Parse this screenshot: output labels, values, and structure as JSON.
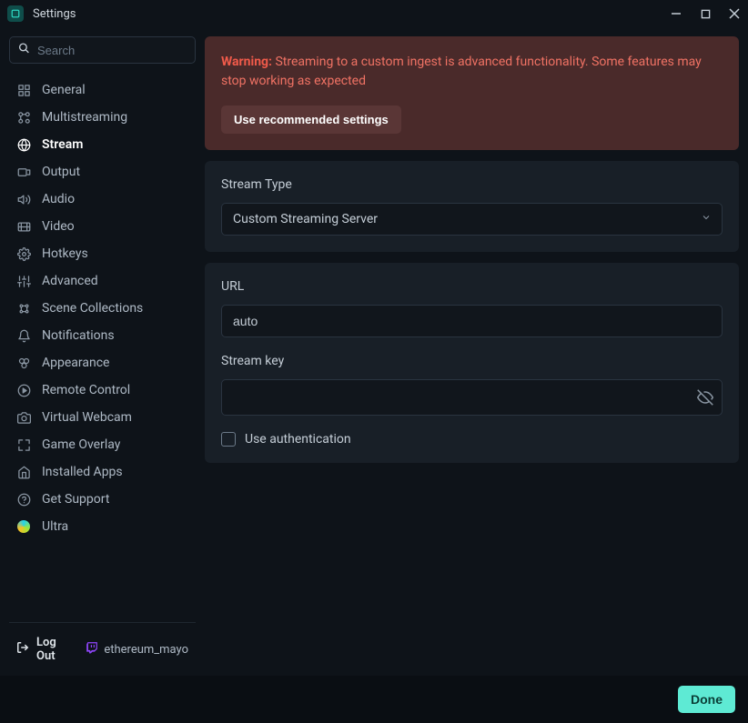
{
  "window": {
    "title": "Settings"
  },
  "search": {
    "placeholder": "Search"
  },
  "sidebar": {
    "items": [
      {
        "icon": "grid",
        "label": "General"
      },
      {
        "icon": "multistream",
        "label": "Multistreaming"
      },
      {
        "icon": "globe",
        "label": "Stream",
        "active": true
      },
      {
        "icon": "output",
        "label": "Output"
      },
      {
        "icon": "audio",
        "label": "Audio"
      },
      {
        "icon": "video",
        "label": "Video"
      },
      {
        "icon": "gear",
        "label": "Hotkeys"
      },
      {
        "icon": "sliders",
        "label": "Advanced"
      },
      {
        "icon": "collections",
        "label": "Scene Collections"
      },
      {
        "icon": "bell",
        "label": "Notifications"
      },
      {
        "icon": "appearance",
        "label": "Appearance"
      },
      {
        "icon": "remote",
        "label": "Remote Control"
      },
      {
        "icon": "camera",
        "label": "Virtual Webcam"
      },
      {
        "icon": "overlay",
        "label": "Game Overlay"
      },
      {
        "icon": "apps",
        "label": "Installed Apps"
      },
      {
        "icon": "help",
        "label": "Get Support"
      },
      {
        "icon": "ultra",
        "label": "Ultra"
      }
    ]
  },
  "footer": {
    "logout_label": "Log Out",
    "username": "ethereum_mayo"
  },
  "warning": {
    "prefix": "Warning:",
    "text": "Streaming to a custom ingest is advanced functionality. Some features may stop working as expected",
    "button": "Use recommended settings"
  },
  "stream_type": {
    "label": "Stream Type",
    "value": "Custom Streaming Server"
  },
  "url": {
    "label": "URL",
    "value": "auto"
  },
  "stream_key": {
    "label": "Stream key",
    "value": ""
  },
  "auth": {
    "label": "Use authentication"
  },
  "done": {
    "label": "Done"
  }
}
